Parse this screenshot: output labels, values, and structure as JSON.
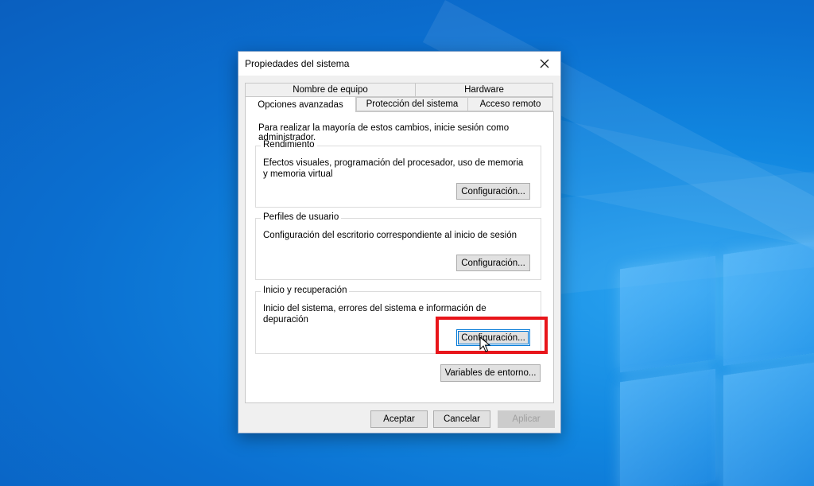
{
  "dialog": {
    "title": "Propiedades del sistema",
    "close_icon": "close-icon"
  },
  "tabs": {
    "row1": [
      {
        "label": "Nombre de equipo"
      },
      {
        "label": "Hardware"
      }
    ],
    "row2": [
      {
        "label": "Opciones avanzadas",
        "active": true
      },
      {
        "label": "Protección del sistema"
      },
      {
        "label": "Acceso remoto"
      }
    ]
  },
  "panel": {
    "admin_note": "Para realizar la mayoría de estos cambios, inicie sesión como administrador.",
    "performance": {
      "title": "Rendimiento",
      "description": "Efectos visuales, programación del procesador, uso de memoria y memoria virtual",
      "button": "Configuración..."
    },
    "profiles": {
      "title": "Perfiles de usuario",
      "description": "Configuración del escritorio correspondiente al inicio de sesión",
      "button": "Configuración..."
    },
    "startup": {
      "title": "Inicio y recuperación",
      "description": "Inicio del sistema, errores del sistema e información de depuración",
      "button": "Configuración..."
    },
    "env_button": "Variables de entorno..."
  },
  "footer": {
    "ok": "Aceptar",
    "cancel": "Cancelar",
    "apply": "Aplicar"
  },
  "colors": {
    "highlight": "#e8151a",
    "focus": "#0078d7"
  }
}
